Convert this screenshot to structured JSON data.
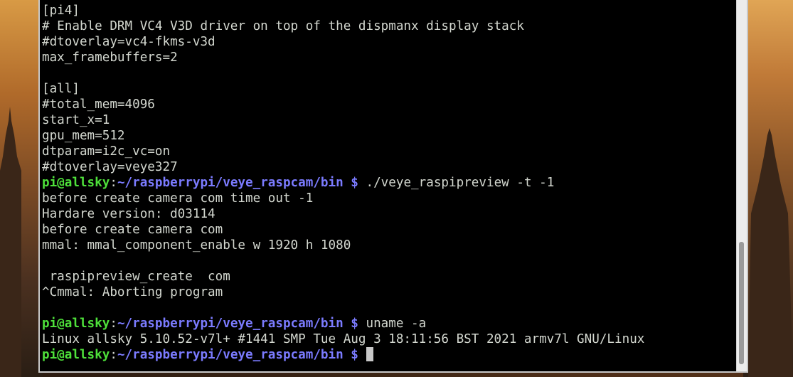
{
  "terminal": {
    "lines": [
      {
        "type": "text",
        "text": "[pi4]"
      },
      {
        "type": "text",
        "text": "# Enable DRM VC4 V3D driver on top of the dispmanx display stack"
      },
      {
        "type": "text",
        "text": "#dtoverlay=vc4-fkms-v3d"
      },
      {
        "type": "text",
        "text": "max_framebuffers=2"
      },
      {
        "type": "text",
        "text": ""
      },
      {
        "type": "text",
        "text": "[all]"
      },
      {
        "type": "text",
        "text": "#total_mem=4096"
      },
      {
        "type": "text",
        "text": "start_x=1"
      },
      {
        "type": "text",
        "text": "gpu_mem=512"
      },
      {
        "type": "text",
        "text": "dtparam=i2c_vc=on"
      },
      {
        "type": "text",
        "text": "#dtoverlay=veye327"
      },
      {
        "type": "prompt",
        "user": "pi@allsky",
        "colon": ":",
        "path": "~/raspberrypi/veye_raspcam/bin",
        "symbol": " $ ",
        "command": "./veye_raspipreview -t -1"
      },
      {
        "type": "text",
        "text": "before create camera com time out -1"
      },
      {
        "type": "text",
        "text": "Hardare version: d03114"
      },
      {
        "type": "text",
        "text": "before create camera com"
      },
      {
        "type": "text",
        "text": "mmal: mmal_component_enable w 1920 h 1080"
      },
      {
        "type": "text",
        "text": ""
      },
      {
        "type": "text",
        "text": " raspipreview_create  com"
      },
      {
        "type": "text",
        "text": "^Cmmal: Aborting program"
      },
      {
        "type": "text",
        "text": ""
      },
      {
        "type": "prompt",
        "user": "pi@allsky",
        "colon": ":",
        "path": "~/raspberrypi/veye_raspcam/bin",
        "symbol": " $ ",
        "command": "uname -a"
      },
      {
        "type": "text",
        "text": "Linux allsky 5.10.52-v7l+ #1441 SMP Tue Aug 3 18:11:56 BST 2021 armv7l GNU/Linux"
      },
      {
        "type": "prompt",
        "user": "pi@allsky",
        "colon": ":",
        "path": "~/raspberrypi/veye_raspcam/bin",
        "symbol": " $ ",
        "command": "",
        "cursor": true
      }
    ]
  },
  "colors": {
    "background": "#000000",
    "text": "#d3d7cf",
    "prompt_user": "#4ee03a",
    "prompt_path": "#7b7bff"
  }
}
